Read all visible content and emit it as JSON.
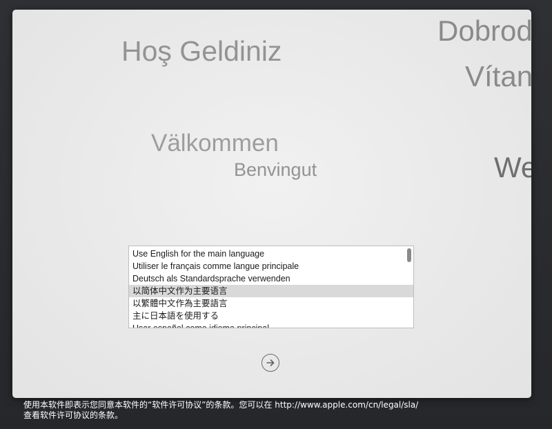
{
  "greetings": {
    "turkish": "Hoş Geldiniz",
    "czech_partial": "Dobrod",
    "czech_partial_2": "Vítan",
    "swedish": "Välkommen",
    "catalan": "Benvingut",
    "english_partial": "We"
  },
  "language_list": {
    "selected_index": 3,
    "items": [
      "Use English for the main language",
      "Utiliser le français comme langue principale",
      "Deutsch als Standardsprache verwenden",
      "以简体中文作为主要语言",
      "以繁體中文作為主要語言",
      "主に日本語を使用する",
      "Usar español como idioma principal"
    ]
  },
  "next_button": {
    "icon": "arrow-right-circle-icon"
  },
  "license": {
    "line1_prefix": "使用本软件即表示您同意本软件的“软件许可协议”的条款。您可以在 ",
    "url": "http://www.apple.com/cn/legal/sla/",
    "line2": "查看软件许可协议的条款。"
  },
  "colors": {
    "background": "#2b2c30",
    "window": "#ececec",
    "selection": "#d9d9d9",
    "greeting_text": "#8c8c8c"
  }
}
